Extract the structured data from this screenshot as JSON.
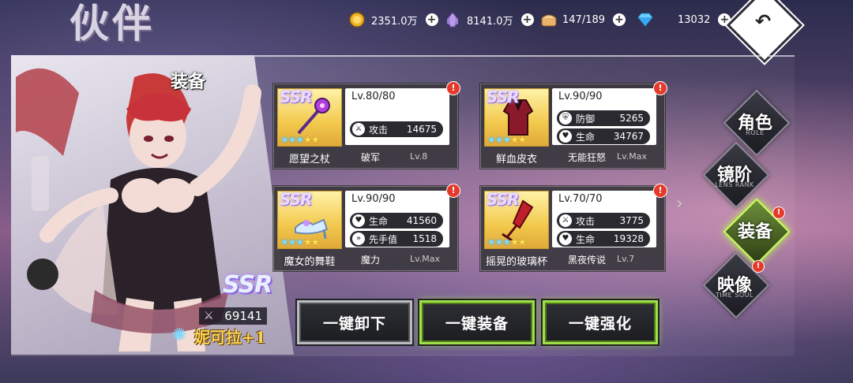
{
  "page": {
    "title": "伙伴",
    "section": "装备"
  },
  "resources": [
    {
      "icon": "gold-coin-icon",
      "value": "2351.0万"
    },
    {
      "icon": "purple-crystal-icon",
      "value": "8141.0万"
    },
    {
      "icon": "bread-stamina-icon",
      "value": "147/189"
    },
    {
      "icon": "blue-diamond-icon",
      "value": "13032"
    }
  ],
  "character": {
    "rarity": "SSR",
    "power": "69141",
    "name": "妮可拉+1"
  },
  "equipment": [
    {
      "rarity": "SSR",
      "stars": 5,
      "level": "Lv.80/80",
      "name": "愿望之杖",
      "rune": "破军",
      "rune_level": "Lv.8",
      "stats": [
        {
          "icon": "swords-icon",
          "name": "攻击",
          "value": "14675"
        }
      ]
    },
    {
      "rarity": "SSR",
      "stars": 5,
      "level": "Lv.90/90",
      "name": "鲜血皮衣",
      "rune": "无能狂怒",
      "rune_level": "Lv.Max",
      "stats": [
        {
          "icon": "shield-icon",
          "name": "防御",
          "value": "5265"
        },
        {
          "icon": "heart-icon",
          "name": "生命",
          "value": "34767"
        }
      ]
    },
    {
      "rarity": "SSR",
      "stars": 5,
      "level": "Lv.90/90",
      "name": "魔女的舞鞋",
      "rune": "魔力",
      "rune_level": "Lv.Max",
      "stats": [
        {
          "icon": "heart-icon",
          "name": "生命",
          "value": "41560"
        },
        {
          "icon": "boot-speed-icon",
          "name": "先手值",
          "value": "1518"
        }
      ]
    },
    {
      "rarity": "SSR",
      "stars": 5,
      "level": "Lv.70/70",
      "name": "摇晃的玻璃杯",
      "rune": "黑夜传说",
      "rune_level": "Lv.7",
      "stats": [
        {
          "icon": "swords-icon",
          "name": "攻击",
          "value": "3775"
        },
        {
          "icon": "heart-icon",
          "name": "生命",
          "value": "19328"
        }
      ]
    }
  ],
  "actions": {
    "unequip_all": "一键卸下",
    "equip_all": "一键装备",
    "enhance_all": "一键强化"
  },
  "tabs": [
    {
      "label": "角色",
      "sub": "ROLE",
      "active": false,
      "alert": false
    },
    {
      "label": "镜阶",
      "sub": "LENS RANK",
      "active": false,
      "alert": false
    },
    {
      "label": "装备",
      "sub": "",
      "active": true,
      "alert": true
    },
    {
      "label": "映像",
      "sub": "TIME SOUL",
      "active": false,
      "alert": true
    }
  ],
  "alert_mark": "!",
  "colors": {
    "accent_green": "#9fe04a",
    "alert_red": "#e53a2a",
    "rarity_purple": "#9060e0"
  }
}
